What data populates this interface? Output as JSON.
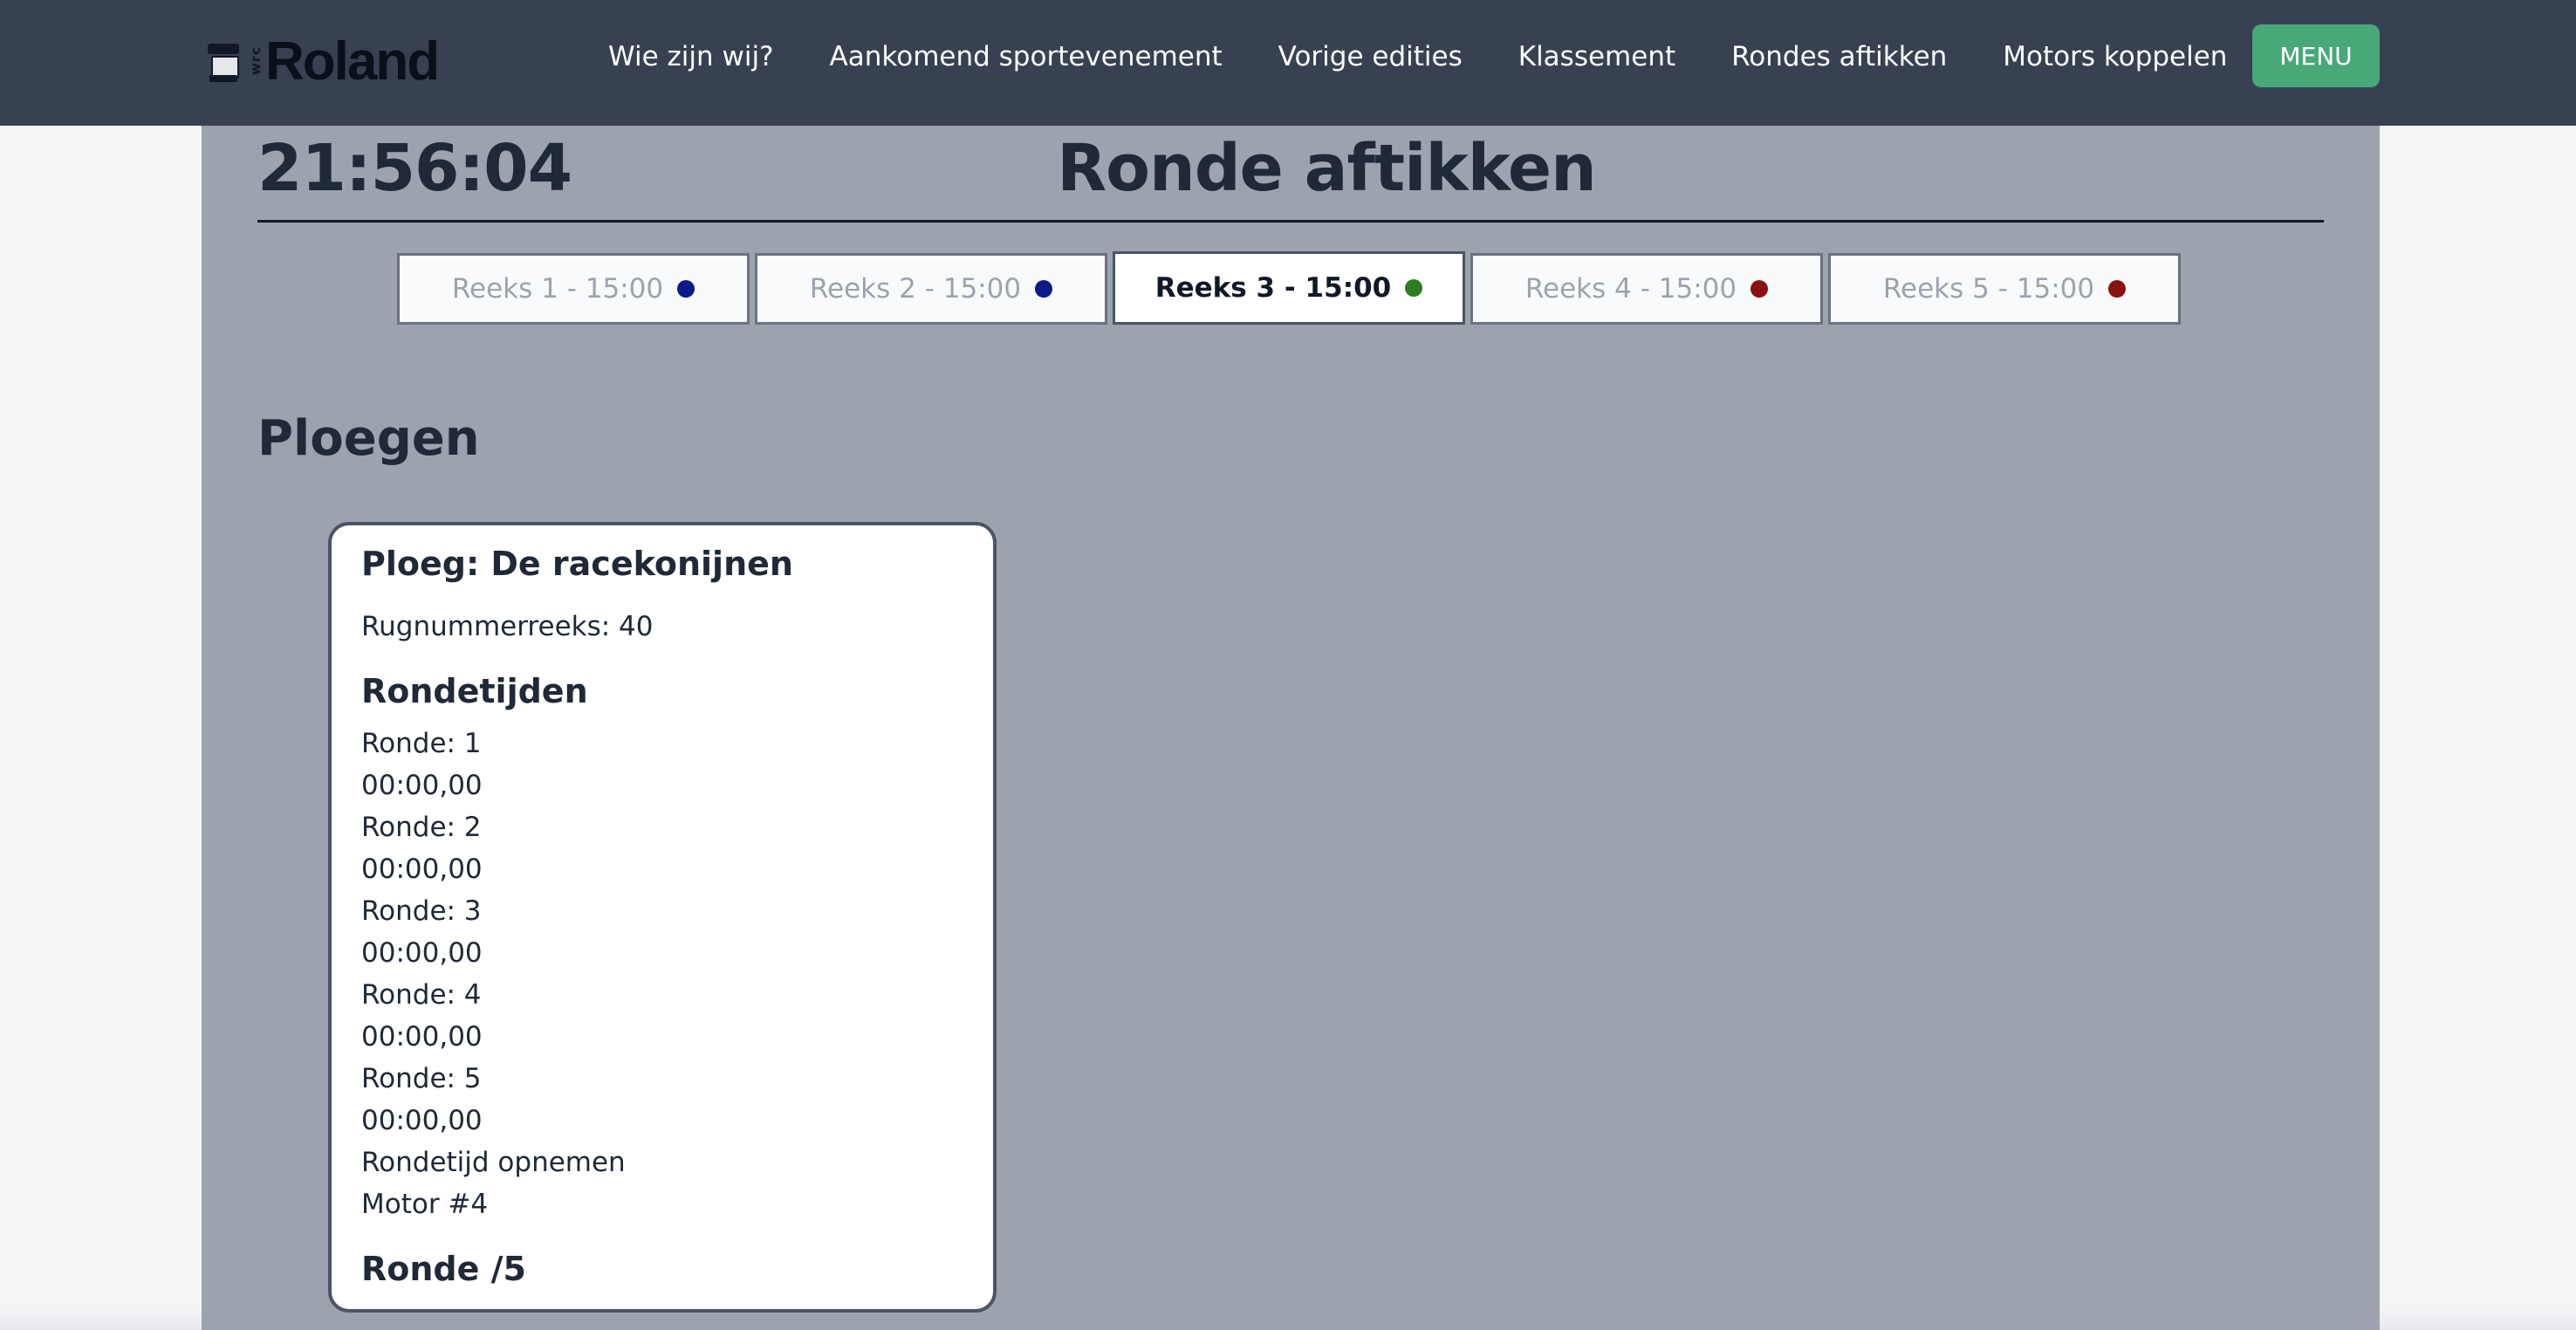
{
  "navbar": {
    "logo_text": "Roland",
    "logo_small_text": "wrc",
    "links": [
      "Wie zijn wij?",
      "Aankomend sportevenement",
      "Vorige edities",
      "Klassement",
      "Rondes aftikken",
      "Motors koppelen"
    ],
    "menu_label": "MENU"
  },
  "header": {
    "clock": "21:56:04",
    "title": "Ronde aftikken"
  },
  "tabs": [
    {
      "label": "Reeks 1 - 15:00",
      "status_color": "#0a1a8a",
      "active": false
    },
    {
      "label": "Reeks 2 - 15:00",
      "status_color": "#0a1a8a",
      "active": false
    },
    {
      "label": "Reeks 3 - 15:00",
      "status_color": "#2e7d20",
      "active": true
    },
    {
      "label": "Reeks 4 - 15:00",
      "status_color": "#8b1010",
      "active": false
    },
    {
      "label": "Reeks 5 - 15:00",
      "status_color": "#8b1010",
      "active": false
    }
  ],
  "section_title": "Ploegen",
  "team_card": {
    "title": "Ploeg: De racekonijnen",
    "bib_series": "Rugnummerreeks: 40",
    "laps_heading": "Rondetijden",
    "laps": [
      {
        "label": "Ronde: 1",
        "time": "00:00,00"
      },
      {
        "label": "Ronde: 2",
        "time": "00:00,00"
      },
      {
        "label": "Ronde: 3",
        "time": "00:00,00"
      },
      {
        "label": "Ronde: 4",
        "time": "00:00,00"
      },
      {
        "label": "Ronde: 5",
        "time": "00:00,00"
      }
    ],
    "record_lap_label": "Rondetijd opnemen",
    "motor_label": "Motor #4",
    "lap_counter": "Ronde /5"
  },
  "icons": {
    "logo": "robot-logo-icon",
    "tab_status": "status-dot-icon"
  }
}
